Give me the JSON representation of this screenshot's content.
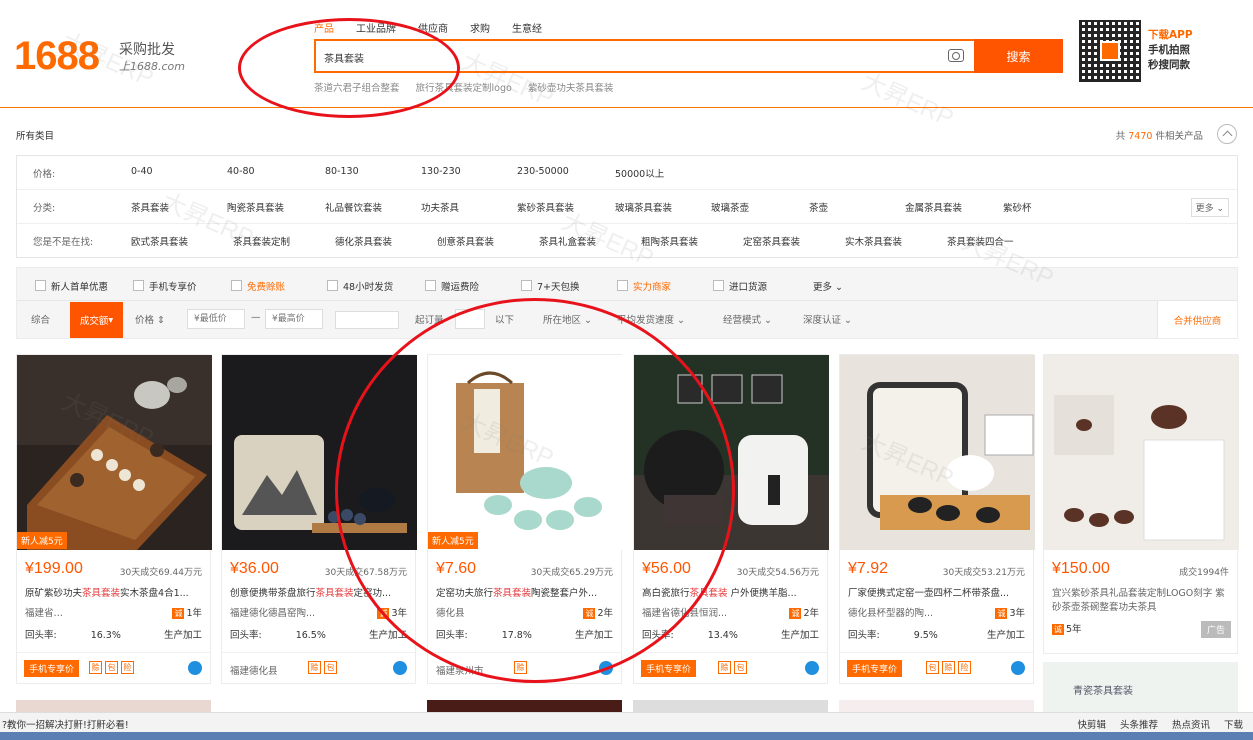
{
  "header": {
    "logo_number": "1688",
    "logo_chinese": "采购批发",
    "logo_url": "上1688.com",
    "search_tabs": [
      "产品",
      "工业品牌",
      "供应商",
      "求购",
      "生意经"
    ],
    "search_value": "茶具套装",
    "search_button": "搜索",
    "hot_words": [
      "茶道六君子组合整套",
      "旅行茶具套装定制logo",
      "紫砂壶功夫茶具套装"
    ],
    "app_line1": "下载APP",
    "app_line2": "手机拍照",
    "app_line3": "秒搜同款"
  },
  "filters": {
    "all_categories": "所有类目",
    "total_prefix": "共",
    "total_count": "7470",
    "total_suffix": "件相关产品",
    "price_label": "价格:",
    "price_ranges": [
      "0-40",
      "40-80",
      "80-130",
      "130-230",
      "230-50000",
      "50000以上"
    ],
    "category_label": "分类:",
    "categories": [
      "茶具套装",
      "陶瓷茶具套装",
      "礼品餐饮套装",
      "功夫茶具",
      "紫砂茶具套装",
      "玻璃茶具套装",
      "玻璃茶壶",
      "茶壶",
      "金属茶具套装",
      "紫砂杯"
    ],
    "more_label": "更多",
    "suggest_label": "您是不是在找:",
    "suggests": [
      "欧式茶具套装",
      "茶具套装定制",
      "德化茶具套装",
      "创意茶具套装",
      "茶具礼盒套装",
      "粗陶茶具套装",
      "定窑茶具套装",
      "实木茶具套装",
      "茶具套装四合一"
    ]
  },
  "toolbar": {
    "checks": [
      "新人首单优惠",
      "手机专享价",
      "免费赊账",
      "48小时发货",
      "赠运费险",
      "7+天包换",
      "实力商家",
      "进口货源"
    ],
    "checks_more": "更多",
    "sort_default": "综合",
    "sort_active": "成交额",
    "sort_price": "价格",
    "min_price": "¥最低价",
    "max_price": "¥最高价",
    "dash": "—",
    "min_order": "起订量",
    "below": "以下",
    "location": "所在地区",
    "ship_speed": "平均发货速度",
    "biz_mode": "经营模式",
    "depth_cert": "深度认证",
    "merge_suppliers": "合并供应商"
  },
  "products": [
    {
      "badge": "新人减5元",
      "price": "¥199.00",
      "deal": "30天成交69.44万元",
      "title_pre": "原矿紫砂功夫",
      "title_hl": "茶具套装",
      "title_post": "实木茶盘4合1...",
      "seller": "福建省…",
      "years": "1年",
      "repeat_label": "回头率:",
      "repeat": "16.3%",
      "fab": "生产加工",
      "phone_tag": "手机专享价",
      "location": ""
    },
    {
      "badge": "",
      "price": "¥36.00",
      "deal": "30天成交67.58万元",
      "title_pre": "创意便携带茶盘旅行",
      "title_hl": "茶具套装",
      "title_post": "定窑功...",
      "seller": "福建德化德昌窑陶...",
      "years": "3年",
      "repeat_label": "回头率:",
      "repeat": "16.5%",
      "fab": "生产加工",
      "phone_tag": "",
      "location": "福建德化县"
    },
    {
      "badge": "新人减5元",
      "price": "¥7.60",
      "deal": "30天成交65.29万元",
      "title_pre": "定窑功夫旅行",
      "title_hl": "茶具套装",
      "title_post": "陶瓷整套户外...",
      "seller": "德化县",
      "years": "2年",
      "repeat_label": "回头率:",
      "repeat": "17.8%",
      "fab": "生产加工",
      "phone_tag": "",
      "location": "福建泉州市"
    },
    {
      "badge": "",
      "price": "¥56.00",
      "deal": "30天成交54.56万元",
      "title_pre": "高白瓷旅行",
      "title_hl": "茶具套装",
      "title_post": " 户外便携羊脂...",
      "seller": "福建省德化县恒润...",
      "years": "2年",
      "repeat_label": "回头率:",
      "repeat": "13.4%",
      "fab": "生产加工",
      "phone_tag": "手机专享价",
      "location": ""
    },
    {
      "badge": "",
      "price": "¥7.92",
      "deal": "30天成交53.21万元",
      "title_pre": "厂家便携式定窑一壶四杯二杯带茶盘...",
      "title_hl": "",
      "title_post": "",
      "seller": "德化县杯型器的陶...",
      "years": "3年",
      "repeat_label": "回头率:",
      "repeat": "9.5%",
      "fab": "生产加工",
      "phone_tag": "手机专享价",
      "location": ""
    }
  ],
  "ad": {
    "price": "¥150.00",
    "deal": "成交1994件",
    "title": "宜兴紫砂茶具礼品套装定制LOGO刻字 紫砂茶壶茶碗整套功夫茶具",
    "years": "5年",
    "tag": "广告",
    "next_banner": "青瓷茶具套装"
  },
  "statusbar": {
    "left": "?教你一招解决打鼾!打鼾必看!",
    "items": [
      "快剪辑",
      "头条推荐",
      "热点资讯",
      "下载"
    ]
  },
  "colors": {
    "brand_orange": "#ff6a00",
    "search_orange": "#ff5500",
    "annotation_red": "#e8121b",
    "highlight_red": "#e4393c"
  },
  "watermark": "大昇ERP"
}
